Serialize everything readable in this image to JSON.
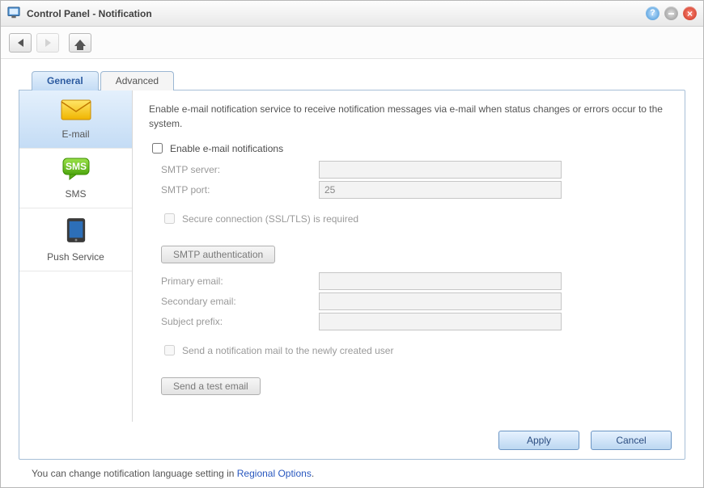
{
  "window": {
    "title": "Control Panel - Notification"
  },
  "tabs": {
    "general": "General",
    "advanced": "Advanced"
  },
  "sidebar": {
    "email": "E-mail",
    "sms": "SMS",
    "push": "Push Service"
  },
  "content": {
    "desc": "Enable e-mail notification service to receive notification messages via e-mail when status changes or errors occur to the system.",
    "enable_label": "Enable e-mail notifications",
    "smtp_server_label": "SMTP server:",
    "smtp_server_value": "",
    "smtp_port_label": "SMTP port:",
    "smtp_port_value": "25",
    "ssl_label": "Secure connection (SSL/TLS) is required",
    "smtp_auth_btn": "SMTP authentication",
    "primary_label": "Primary email:",
    "primary_value": "",
    "secondary_label": "Secondary email:",
    "secondary_value": "",
    "subject_label": "Subject prefix:",
    "subject_value": "",
    "newuser_label": "Send a notification mail to the newly created user",
    "send_test_btn": "Send a test email"
  },
  "buttons": {
    "apply": "Apply",
    "cancel": "Cancel"
  },
  "footer": {
    "text": "You can change notification language setting in ",
    "link": "Regional Options",
    "suffix": "."
  },
  "titlebar_icons": {
    "help": "?",
    "close": "×"
  }
}
